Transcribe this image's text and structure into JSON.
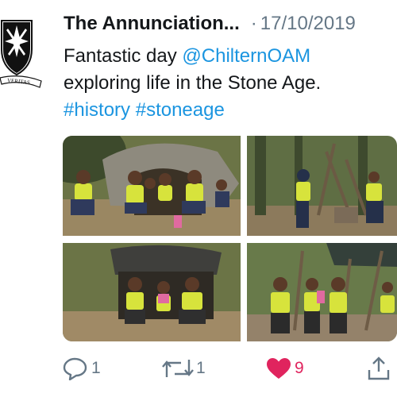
{
  "tweet": {
    "author_name": "The Annunciation...",
    "separator": "·",
    "date": "17/10/2019",
    "text_line1_prefix": "Fantastic day ",
    "mention": "@ChilternOAM",
    "text_line2": "exploring life in the Stone Age.",
    "hashtag1": "#history",
    "hashtag2": "#stoneage",
    "avatar_motto": "VERITAS"
  },
  "actions": {
    "reply_count": "1",
    "retweet_count": "1",
    "like_count": "9",
    "liked": true
  },
  "colors": {
    "link": "#1b95e0",
    "like": "#e0245e",
    "muted": "#657786"
  },
  "media": {
    "photo_count": 4
  }
}
